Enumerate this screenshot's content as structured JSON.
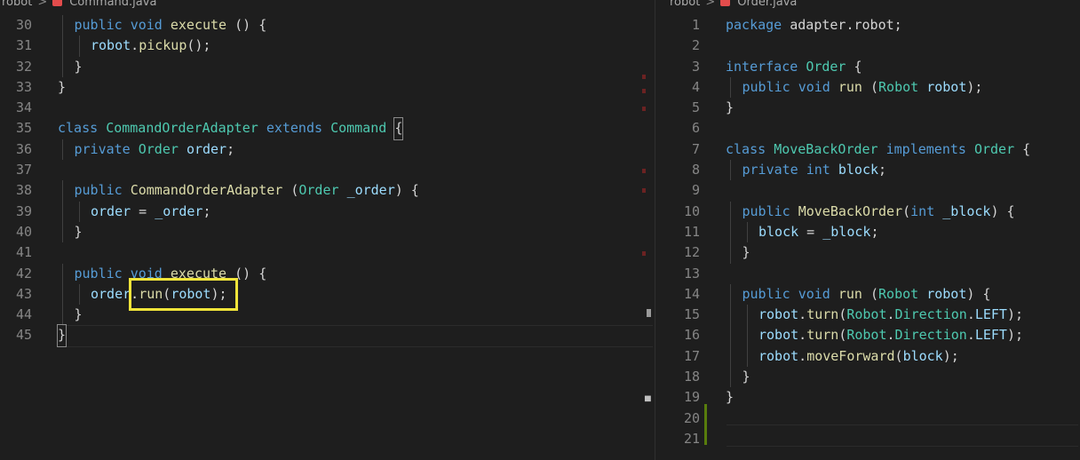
{
  "left_editor": {
    "breadcrumb": {
      "folder": "robot",
      "separator": ">",
      "file": "Command.java"
    },
    "lines": [
      {
        "num": "30",
        "indent": 1,
        "tokens": [
          [
            "kw",
            "public"
          ],
          [
            "pl",
            " "
          ],
          [
            "kw",
            "void"
          ],
          [
            "pl",
            " "
          ],
          [
            "fn",
            "execute"
          ],
          [
            "pl",
            " () {"
          ]
        ]
      },
      {
        "num": "31",
        "indent": 2,
        "tokens": [
          [
            "vr",
            "robot"
          ],
          [
            "pl",
            "."
          ],
          [
            "fn",
            "pickup"
          ],
          [
            "pl",
            "();"
          ]
        ]
      },
      {
        "num": "32",
        "indent": 1,
        "tokens": [
          [
            "pl",
            "}"
          ]
        ]
      },
      {
        "num": "33",
        "indent": 0,
        "tokens": [
          [
            "pl",
            "}"
          ]
        ]
      },
      {
        "num": "34",
        "indent": 0,
        "tokens": []
      },
      {
        "num": "35",
        "indent": 0,
        "tokens": [
          [
            "kw",
            "class"
          ],
          [
            "pl",
            " "
          ],
          [
            "ty",
            "CommandOrderAdapter"
          ],
          [
            "pl",
            " "
          ],
          [
            "kw",
            "extends"
          ],
          [
            "pl",
            " "
          ],
          [
            "ty",
            "Command"
          ],
          [
            "pl",
            " "
          ],
          [
            "box",
            "{"
          ]
        ]
      },
      {
        "num": "36",
        "indent": 1,
        "tokens": [
          [
            "kw",
            "private"
          ],
          [
            "pl",
            " "
          ],
          [
            "ty",
            "Order"
          ],
          [
            "pl",
            " "
          ],
          [
            "vr",
            "order"
          ],
          [
            "pl",
            ";"
          ]
        ]
      },
      {
        "num": "37",
        "indent": 0,
        "tokens": []
      },
      {
        "num": "38",
        "indent": 1,
        "tokens": [
          [
            "kw",
            "public"
          ],
          [
            "pl",
            " "
          ],
          [
            "fn",
            "CommandOrderAdapter"
          ],
          [
            "pl",
            " ("
          ],
          [
            "ty",
            "Order"
          ],
          [
            "pl",
            " "
          ],
          [
            "vr",
            "_order"
          ],
          [
            "pl",
            ") {"
          ]
        ]
      },
      {
        "num": "39",
        "indent": 2,
        "tokens": [
          [
            "vr",
            "order"
          ],
          [
            "pl",
            " = "
          ],
          [
            "vr",
            "_order"
          ],
          [
            "pl",
            ";"
          ]
        ]
      },
      {
        "num": "40",
        "indent": 1,
        "tokens": [
          [
            "pl",
            "}"
          ]
        ]
      },
      {
        "num": "41",
        "indent": 0,
        "tokens": []
      },
      {
        "num": "42",
        "indent": 1,
        "tokens": [
          [
            "kw",
            "public"
          ],
          [
            "pl",
            " "
          ],
          [
            "kw",
            "void"
          ],
          [
            "pl",
            " "
          ],
          [
            "fn",
            "execute"
          ],
          [
            "pl",
            " () {"
          ]
        ]
      },
      {
        "num": "43",
        "indent": 2,
        "tokens": [
          [
            "vr",
            "order"
          ],
          [
            "pl",
            "."
          ],
          [
            "fn",
            "run"
          ],
          [
            "pl",
            "("
          ],
          [
            "vr",
            "robot"
          ],
          [
            "pl",
            ");"
          ]
        ]
      },
      {
        "num": "44",
        "indent": 1,
        "tokens": [
          [
            "pl",
            "}"
          ]
        ]
      },
      {
        "num": "45",
        "indent": 0,
        "tokens": [
          [
            "box",
            "}"
          ]
        ]
      }
    ]
  },
  "right_editor": {
    "breadcrumb": {
      "folder": "robot",
      "separator": ">",
      "file": "Order.java"
    },
    "lines": [
      {
        "num": "1",
        "indent": 0,
        "tokens": [
          [
            "kw",
            "package"
          ],
          [
            "pl",
            " adapter.robot;"
          ]
        ]
      },
      {
        "num": "2",
        "indent": 0,
        "tokens": []
      },
      {
        "num": "3",
        "indent": 0,
        "tokens": [
          [
            "kw",
            "interface"
          ],
          [
            "pl",
            " "
          ],
          [
            "ty",
            "Order"
          ],
          [
            "pl",
            " {"
          ]
        ]
      },
      {
        "num": "4",
        "indent": 1,
        "tokens": [
          [
            "kw",
            "public"
          ],
          [
            "pl",
            " "
          ],
          [
            "kw",
            "void"
          ],
          [
            "pl",
            " "
          ],
          [
            "fn",
            "run"
          ],
          [
            "pl",
            " ("
          ],
          [
            "ty",
            "Robot"
          ],
          [
            "pl",
            " "
          ],
          [
            "vr",
            "robot"
          ],
          [
            "pl",
            ");"
          ]
        ]
      },
      {
        "num": "5",
        "indent": 0,
        "tokens": [
          [
            "pl",
            "}"
          ]
        ]
      },
      {
        "num": "6",
        "indent": 0,
        "tokens": []
      },
      {
        "num": "7",
        "indent": 0,
        "tokens": [
          [
            "kw",
            "class"
          ],
          [
            "pl",
            " "
          ],
          [
            "ty",
            "MoveBackOrder"
          ],
          [
            "pl",
            " "
          ],
          [
            "kw",
            "implements"
          ],
          [
            "pl",
            " "
          ],
          [
            "ty",
            "Order"
          ],
          [
            "pl",
            " {"
          ]
        ]
      },
      {
        "num": "8",
        "indent": 1,
        "tokens": [
          [
            "kw",
            "private"
          ],
          [
            "pl",
            " "
          ],
          [
            "kw",
            "int"
          ],
          [
            "pl",
            " "
          ],
          [
            "vr",
            "block"
          ],
          [
            "pl",
            ";"
          ]
        ]
      },
      {
        "num": "9",
        "indent": 0,
        "tokens": []
      },
      {
        "num": "10",
        "indent": 1,
        "tokens": [
          [
            "kw",
            "public"
          ],
          [
            "pl",
            " "
          ],
          [
            "fn",
            "MoveBackOrder"
          ],
          [
            "pl",
            "("
          ],
          [
            "kw",
            "int"
          ],
          [
            "pl",
            " "
          ],
          [
            "vr",
            "_block"
          ],
          [
            "pl",
            ") {"
          ]
        ]
      },
      {
        "num": "11",
        "indent": 2,
        "tokens": [
          [
            "vr",
            "block"
          ],
          [
            "pl",
            " = "
          ],
          [
            "vr",
            "_block"
          ],
          [
            "pl",
            ";"
          ]
        ]
      },
      {
        "num": "12",
        "indent": 1,
        "tokens": [
          [
            "pl",
            "}"
          ]
        ]
      },
      {
        "num": "13",
        "indent": 0,
        "tokens": []
      },
      {
        "num": "14",
        "indent": 1,
        "tokens": [
          [
            "kw",
            "public"
          ],
          [
            "pl",
            " "
          ],
          [
            "kw",
            "void"
          ],
          [
            "pl",
            " "
          ],
          [
            "fn",
            "run"
          ],
          [
            "pl",
            " ("
          ],
          [
            "ty",
            "Robot"
          ],
          [
            "pl",
            " "
          ],
          [
            "vr",
            "robot"
          ],
          [
            "pl",
            ") {"
          ]
        ]
      },
      {
        "num": "15",
        "indent": 2,
        "tokens": [
          [
            "vr",
            "robot"
          ],
          [
            "pl",
            "."
          ],
          [
            "fn",
            "turn"
          ],
          [
            "pl",
            "("
          ],
          [
            "ty",
            "Robot"
          ],
          [
            "pl",
            "."
          ],
          [
            "ty",
            "Direction"
          ],
          [
            "pl",
            "."
          ],
          [
            "vr",
            "LEFT"
          ],
          [
            "pl",
            ");"
          ]
        ]
      },
      {
        "num": "16",
        "indent": 2,
        "tokens": [
          [
            "vr",
            "robot"
          ],
          [
            "pl",
            "."
          ],
          [
            "fn",
            "turn"
          ],
          [
            "pl",
            "("
          ],
          [
            "ty",
            "Robot"
          ],
          [
            "pl",
            "."
          ],
          [
            "ty",
            "Direction"
          ],
          [
            "pl",
            "."
          ],
          [
            "vr",
            "LEFT"
          ],
          [
            "pl",
            ");"
          ]
        ]
      },
      {
        "num": "17",
        "indent": 2,
        "tokens": [
          [
            "vr",
            "robot"
          ],
          [
            "pl",
            "."
          ],
          [
            "fn",
            "moveForward"
          ],
          [
            "pl",
            "("
          ],
          [
            "vr",
            "block"
          ],
          [
            "pl",
            ");"
          ]
        ]
      },
      {
        "num": "18",
        "indent": 1,
        "tokens": [
          [
            "pl",
            "}"
          ]
        ]
      },
      {
        "num": "19",
        "indent": 0,
        "tokens": [
          [
            "pl",
            "}"
          ]
        ]
      },
      {
        "num": "20",
        "indent": 0,
        "tokens": []
      },
      {
        "num": "21",
        "indent": 0,
        "tokens": []
      }
    ]
  },
  "colors": {
    "background": "#1e1e1e",
    "keyword": "#569cd6",
    "type": "#4ec9b0",
    "function": "#dcdcaa",
    "variable": "#9cdcfe",
    "plain": "#d4d4d4",
    "line_number": "#858585",
    "highlight_box": "#f0e43a",
    "modified_gutter": "#587c0c"
  },
  "icons": {
    "file": "java-file-icon",
    "separator": "chevron-right-icon"
  }
}
